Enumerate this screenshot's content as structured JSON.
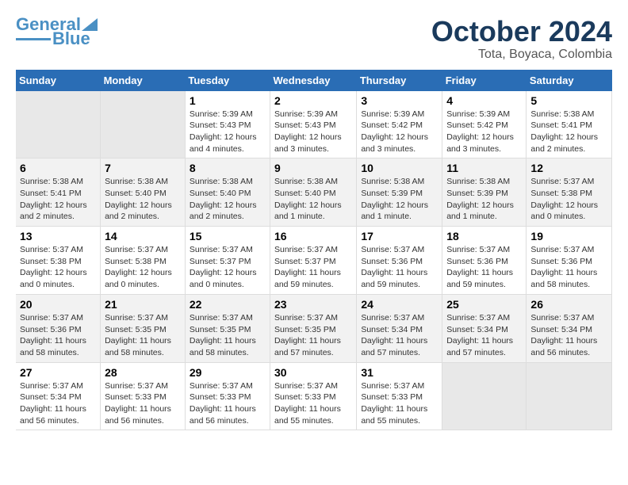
{
  "logo": {
    "line1": "General",
    "line2": "Blue"
  },
  "header": {
    "month": "October 2024",
    "location": "Tota, Boyaca, Colombia"
  },
  "weekdays": [
    "Sunday",
    "Monday",
    "Tuesday",
    "Wednesday",
    "Thursday",
    "Friday",
    "Saturday"
  ],
  "weeks": [
    [
      {
        "day": "",
        "info": ""
      },
      {
        "day": "",
        "info": ""
      },
      {
        "day": "1",
        "info": "Sunrise: 5:39 AM\nSunset: 5:43 PM\nDaylight: 12 hours and 4 minutes."
      },
      {
        "day": "2",
        "info": "Sunrise: 5:39 AM\nSunset: 5:43 PM\nDaylight: 12 hours and 3 minutes."
      },
      {
        "day": "3",
        "info": "Sunrise: 5:39 AM\nSunset: 5:42 PM\nDaylight: 12 hours and 3 minutes."
      },
      {
        "day": "4",
        "info": "Sunrise: 5:39 AM\nSunset: 5:42 PM\nDaylight: 12 hours and 3 minutes."
      },
      {
        "day": "5",
        "info": "Sunrise: 5:38 AM\nSunset: 5:41 PM\nDaylight: 12 hours and 2 minutes."
      }
    ],
    [
      {
        "day": "6",
        "info": "Sunrise: 5:38 AM\nSunset: 5:41 PM\nDaylight: 12 hours and 2 minutes."
      },
      {
        "day": "7",
        "info": "Sunrise: 5:38 AM\nSunset: 5:40 PM\nDaylight: 12 hours and 2 minutes."
      },
      {
        "day": "8",
        "info": "Sunrise: 5:38 AM\nSunset: 5:40 PM\nDaylight: 12 hours and 2 minutes."
      },
      {
        "day": "9",
        "info": "Sunrise: 5:38 AM\nSunset: 5:40 PM\nDaylight: 12 hours and 1 minute."
      },
      {
        "day": "10",
        "info": "Sunrise: 5:38 AM\nSunset: 5:39 PM\nDaylight: 12 hours and 1 minute."
      },
      {
        "day": "11",
        "info": "Sunrise: 5:38 AM\nSunset: 5:39 PM\nDaylight: 12 hours and 1 minute."
      },
      {
        "day": "12",
        "info": "Sunrise: 5:37 AM\nSunset: 5:38 PM\nDaylight: 12 hours and 0 minutes."
      }
    ],
    [
      {
        "day": "13",
        "info": "Sunrise: 5:37 AM\nSunset: 5:38 PM\nDaylight: 12 hours and 0 minutes."
      },
      {
        "day": "14",
        "info": "Sunrise: 5:37 AM\nSunset: 5:38 PM\nDaylight: 12 hours and 0 minutes."
      },
      {
        "day": "15",
        "info": "Sunrise: 5:37 AM\nSunset: 5:37 PM\nDaylight: 12 hours and 0 minutes."
      },
      {
        "day": "16",
        "info": "Sunrise: 5:37 AM\nSunset: 5:37 PM\nDaylight: 11 hours and 59 minutes."
      },
      {
        "day": "17",
        "info": "Sunrise: 5:37 AM\nSunset: 5:36 PM\nDaylight: 11 hours and 59 minutes."
      },
      {
        "day": "18",
        "info": "Sunrise: 5:37 AM\nSunset: 5:36 PM\nDaylight: 11 hours and 59 minutes."
      },
      {
        "day": "19",
        "info": "Sunrise: 5:37 AM\nSunset: 5:36 PM\nDaylight: 11 hours and 58 minutes."
      }
    ],
    [
      {
        "day": "20",
        "info": "Sunrise: 5:37 AM\nSunset: 5:36 PM\nDaylight: 11 hours and 58 minutes."
      },
      {
        "day": "21",
        "info": "Sunrise: 5:37 AM\nSunset: 5:35 PM\nDaylight: 11 hours and 58 minutes."
      },
      {
        "day": "22",
        "info": "Sunrise: 5:37 AM\nSunset: 5:35 PM\nDaylight: 11 hours and 58 minutes."
      },
      {
        "day": "23",
        "info": "Sunrise: 5:37 AM\nSunset: 5:35 PM\nDaylight: 11 hours and 57 minutes."
      },
      {
        "day": "24",
        "info": "Sunrise: 5:37 AM\nSunset: 5:34 PM\nDaylight: 11 hours and 57 minutes."
      },
      {
        "day": "25",
        "info": "Sunrise: 5:37 AM\nSunset: 5:34 PM\nDaylight: 11 hours and 57 minutes."
      },
      {
        "day": "26",
        "info": "Sunrise: 5:37 AM\nSunset: 5:34 PM\nDaylight: 11 hours and 56 minutes."
      }
    ],
    [
      {
        "day": "27",
        "info": "Sunrise: 5:37 AM\nSunset: 5:34 PM\nDaylight: 11 hours and 56 minutes."
      },
      {
        "day": "28",
        "info": "Sunrise: 5:37 AM\nSunset: 5:33 PM\nDaylight: 11 hours and 56 minutes."
      },
      {
        "day": "29",
        "info": "Sunrise: 5:37 AM\nSunset: 5:33 PM\nDaylight: 11 hours and 56 minutes."
      },
      {
        "day": "30",
        "info": "Sunrise: 5:37 AM\nSunset: 5:33 PM\nDaylight: 11 hours and 55 minutes."
      },
      {
        "day": "31",
        "info": "Sunrise: 5:37 AM\nSunset: 5:33 PM\nDaylight: 11 hours and 55 minutes."
      },
      {
        "day": "",
        "info": ""
      },
      {
        "day": "",
        "info": ""
      }
    ]
  ]
}
